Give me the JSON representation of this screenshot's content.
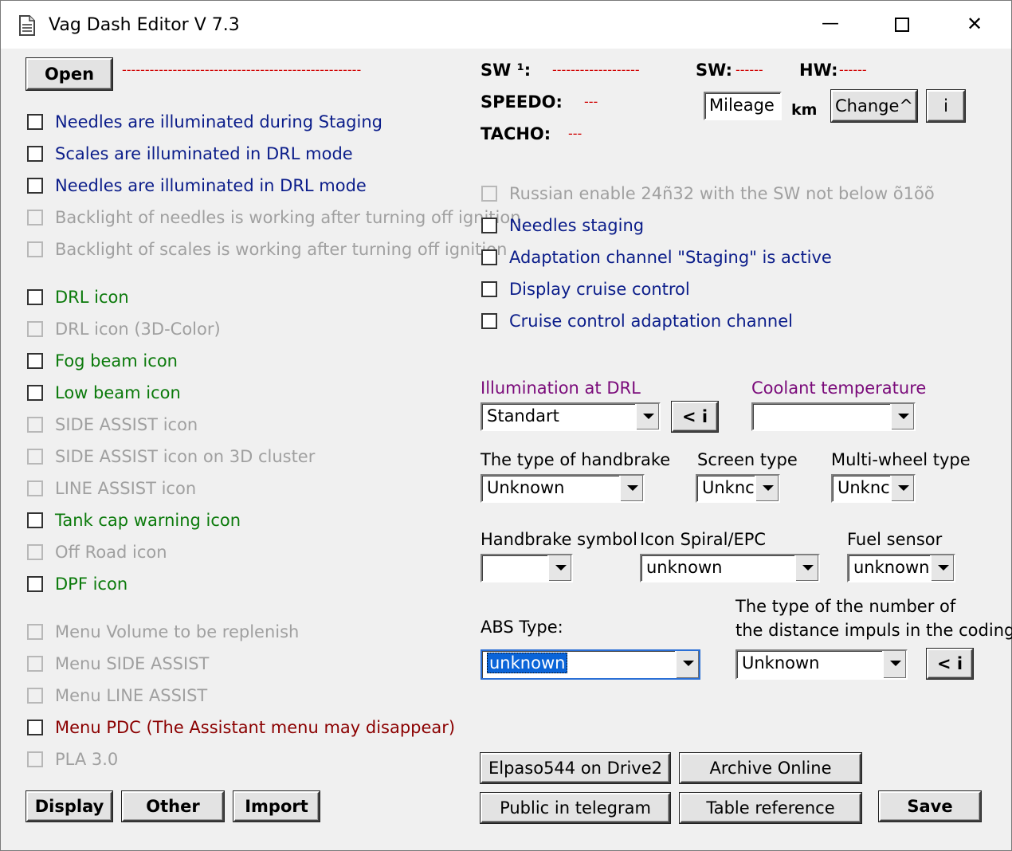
{
  "window": {
    "title": "Vag Dash Editor V 7.3",
    "icon": "document-icon",
    "min_glyph": "—",
    "max_glyph": "☐",
    "close_glyph": "✕"
  },
  "top": {
    "open_label": "Open",
    "file_dashes": "----------------------------------------------------",
    "sw1_label": "SW ¹:",
    "sw1_value": "-------------------",
    "sw_label": "SW:",
    "sw_value": "------",
    "hw_label": "HW:",
    "hw_value": "------",
    "speedo_label": "SPEEDO:",
    "speedo_value": "---",
    "tacho_label": "TACHO:",
    "tacho_value": "---",
    "mileage_value": "Mileage",
    "km_label": "km",
    "change_label": "Change^",
    "info_label": "i"
  },
  "left_checks": [
    {
      "label": "Needles are illuminated during Staging",
      "style": "blue"
    },
    {
      "label": "Scales are illuminated in DRL mode",
      "style": "blue"
    },
    {
      "label": "Needles are illuminated in DRL mode",
      "style": "blue"
    },
    {
      "label": "Backlight of needles is working after turning off ignition",
      "style": "dis"
    },
    {
      "label": "Backlight of scales is working after turning off ignition",
      "style": "dis"
    },
    {
      "label": "DRL icon",
      "style": "green"
    },
    {
      "label": "DRL icon (3D-Color)",
      "style": "dis"
    },
    {
      "label": "Fog beam icon",
      "style": "green"
    },
    {
      "label": "Low beam icon",
      "style": "green"
    },
    {
      "label": "SIDE ASSIST icon",
      "style": "dis"
    },
    {
      "label": "SIDE ASSIST icon on 3D cluster",
      "style": "dis"
    },
    {
      "label": "LINE ASSIST icon",
      "style": "dis"
    },
    {
      "label": "Tank cap warning icon",
      "style": "green"
    },
    {
      "label": "Off Road icon",
      "style": "dis"
    },
    {
      "label": "DPF icon",
      "style": "green"
    },
    {
      "label": "Menu Volume to be replenish",
      "style": "dis"
    },
    {
      "label": "Menu SIDE ASSIST",
      "style": "dis"
    },
    {
      "label": "Menu LINE ASSIST",
      "style": "dis"
    },
    {
      "label": "Menu PDC (The Assistant menu may disappear)",
      "style": "dred"
    },
    {
      "label": "PLA 3.0",
      "style": "dis"
    }
  ],
  "right_checks": [
    {
      "label": "Russian enable  24ñ32 with the SW not below õ1õõ",
      "style": "dis"
    },
    {
      "label": "Needles staging",
      "style": "blue"
    },
    {
      "label": "Adaptation channel \"Staging\" is active",
      "style": "blue"
    },
    {
      "label": "Display cruise control",
      "style": "blue"
    },
    {
      "label": "Cruise control adaptation channel",
      "style": "blue"
    }
  ],
  "fields": {
    "illum_label": "Illumination at DRL",
    "illum_value": "Standart",
    "illum_info": "< i",
    "coolant_label": "Coolant temperature",
    "coolant_value": "",
    "handbrake_type_label": "The type of handbrake",
    "handbrake_type_value": "Unknown",
    "screen_label": "Screen type",
    "screen_value": "Unknc",
    "multiwheel_label": "Multi-wheel type",
    "multiwheel_value": "Unknc",
    "handbrake_symbol_label": "Handbrake symbol",
    "handbrake_symbol_value": "",
    "spiral_label": "Icon Spiral/EPC",
    "spiral_value": "unknown",
    "fuel_label": "Fuel sensor",
    "fuel_value": "unknown",
    "abs_label": "ABS Type:",
    "abs_value": "unknown",
    "impuls_label_1": "The type of the number of",
    "impuls_label_2": "the distance impuls in the coding",
    "impuls_value": "Unknown",
    "impuls_info": "< i"
  },
  "bottom": {
    "display_label": "Display",
    "other_label": "Other",
    "import_label": "Import",
    "drive2_label": "Elpaso544 on Drive2",
    "archive_label": "Archive Online",
    "telegram_label": "Public in telegram",
    "table_label": "Table reference",
    "save_label": "Save"
  }
}
